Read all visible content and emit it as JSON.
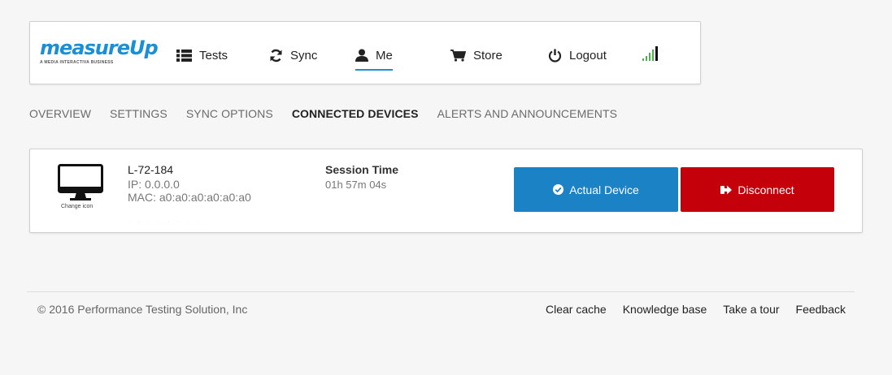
{
  "brand": {
    "logo_text": "measureUp",
    "tagline": "A MEDIA INTERACTIVA BUSINESS",
    "accent_color": "#1a8fd6"
  },
  "nav": {
    "items": [
      {
        "label": "Tests",
        "icon": "list-icon"
      },
      {
        "label": "Sync",
        "icon": "sync-icon"
      },
      {
        "label": "Me",
        "icon": "user-icon",
        "active": true
      },
      {
        "label": "Store",
        "icon": "cart-icon"
      },
      {
        "label": "Logout",
        "icon": "power-icon"
      }
    ],
    "signal_icon": "signal-strength-icon"
  },
  "tabs": [
    {
      "label": "OVERVIEW"
    },
    {
      "label": "SETTINGS"
    },
    {
      "label": "SYNC OPTIONS"
    },
    {
      "label": "CONNECTED DEVICES",
      "active": true
    },
    {
      "label": "ALERTS AND ANNOUNCEMENTS"
    }
  ],
  "device": {
    "icon": "monitor-icon",
    "change_icon_label": "Change icon",
    "name": "L-72-184",
    "ip": "IP: 0.0.0.0",
    "mac": "MAC: a0:a0:a0:a0:a0:a0",
    "session_label": "Session Time",
    "session_value": "01h 57m 04s",
    "actual_button": "Actual Device",
    "disconnect_button": "Disconnect",
    "actual_color": "#1a82c5",
    "disconnect_color": "#c4000b"
  },
  "footer": {
    "copyright": "© 2016 Performance Testing Solution, Inc",
    "links": [
      "Clear cache",
      "Knowledge base",
      "Take a tour",
      "Feedback"
    ]
  }
}
